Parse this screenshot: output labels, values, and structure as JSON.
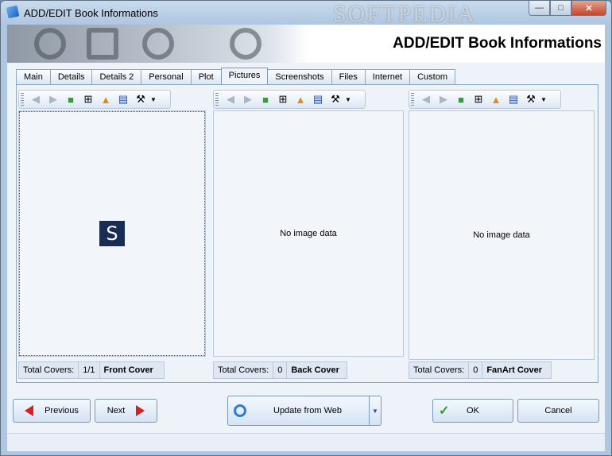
{
  "window": {
    "title": "ADD/EDIT Book Informations",
    "watermark": "SOFTPEDIA"
  },
  "header": {
    "title": "ADD/EDIT Book Informations"
  },
  "tabs": [
    "Main",
    "Details",
    "Details 2",
    "Personal",
    "Plot",
    "Pictures",
    "Screenshots",
    "Files",
    "Internet",
    "Custom"
  ],
  "active_tab": "Pictures",
  "toolbar_icons": [
    "arrow-left-icon",
    "arrow-right-icon",
    "image-icon",
    "add-list-icon",
    "open-folder-icon",
    "film-strip-icon",
    "wrench-icon",
    "dropdown-arrow-icon"
  ],
  "panels": [
    {
      "no_image": "",
      "total_label": "Total Covers:",
      "count": "1/1",
      "cover_name": "Front Cover",
      "logo": "S"
    },
    {
      "no_image": "No image data",
      "total_label": "Total Covers:",
      "count": "0",
      "cover_name": "Back Cover"
    },
    {
      "no_image": "No image data",
      "total_label": "Total Covers:",
      "count": "0",
      "cover_name": "FanArt Cover"
    }
  ],
  "buttons": {
    "previous": "Previous",
    "next": "Next",
    "update": "Update from Web",
    "ok": "OK",
    "cancel": "Cancel"
  },
  "colors": {
    "accent": "#1e5fb0",
    "arrow_red": "#d62020",
    "ok_green": "#2a9d2a"
  }
}
